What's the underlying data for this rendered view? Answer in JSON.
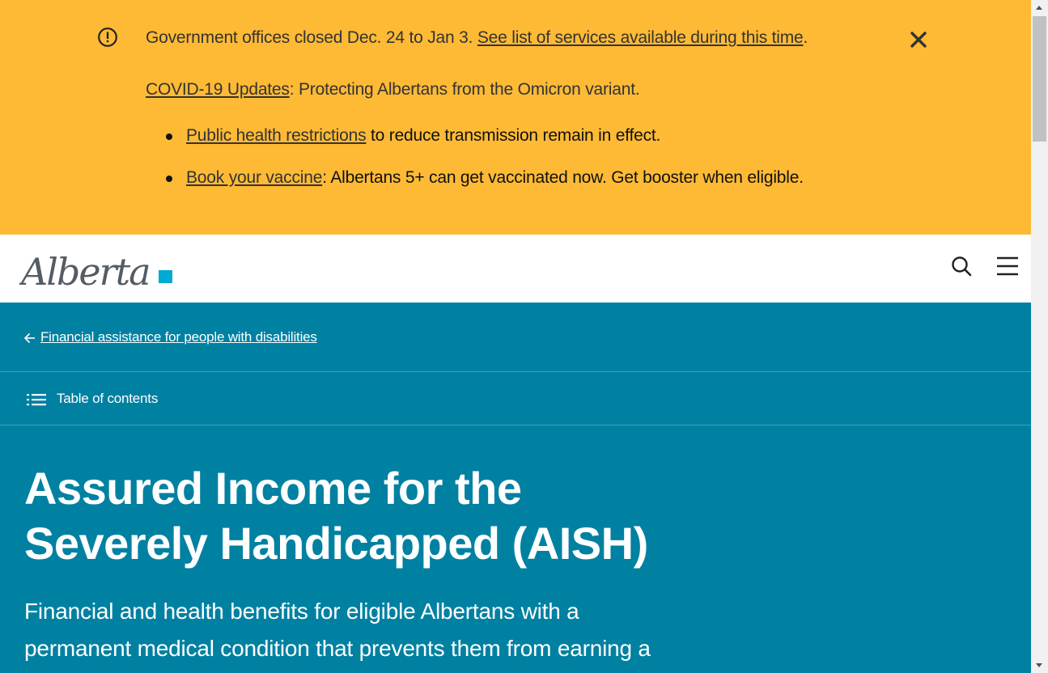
{
  "alert": {
    "icon": "exclamation-circle-icon",
    "closure_text": "Government offices closed Dec. 24 to Jan 3.",
    "closure_link": "See list of services available during this time",
    "closure_end": ".",
    "covid_link": "COVID-19 Updates",
    "covid_text": ": Protecting Albertans from the Omicron variant.",
    "bullets": [
      {
        "link": "Public health restrictions",
        "text": " to reduce transmission remain in effect."
      },
      {
        "link": "Book your vaccine",
        "text": ": Albertans 5+ can get vaccinated now. Get booster when eligible."
      }
    ],
    "close_icon": "close-icon",
    "background": "#feba35"
  },
  "header": {
    "logo_text": "Alberta",
    "search_icon": "search-icon",
    "menu_icon": "hamburger-menu-icon",
    "logo_accent": "#00aad2"
  },
  "hero": {
    "breadcrumb": "Financial assistance for people with disabilities",
    "toc_label": "Table of contents",
    "title_line1": "Assured Income for the",
    "title_line2": "Severely Handicapped (AISH)",
    "lede_line1": "Financial and health benefits for eligible Albertans with a",
    "lede_line2": "permanent medical condition that prevents them from earning a",
    "background": "#0081a2"
  }
}
